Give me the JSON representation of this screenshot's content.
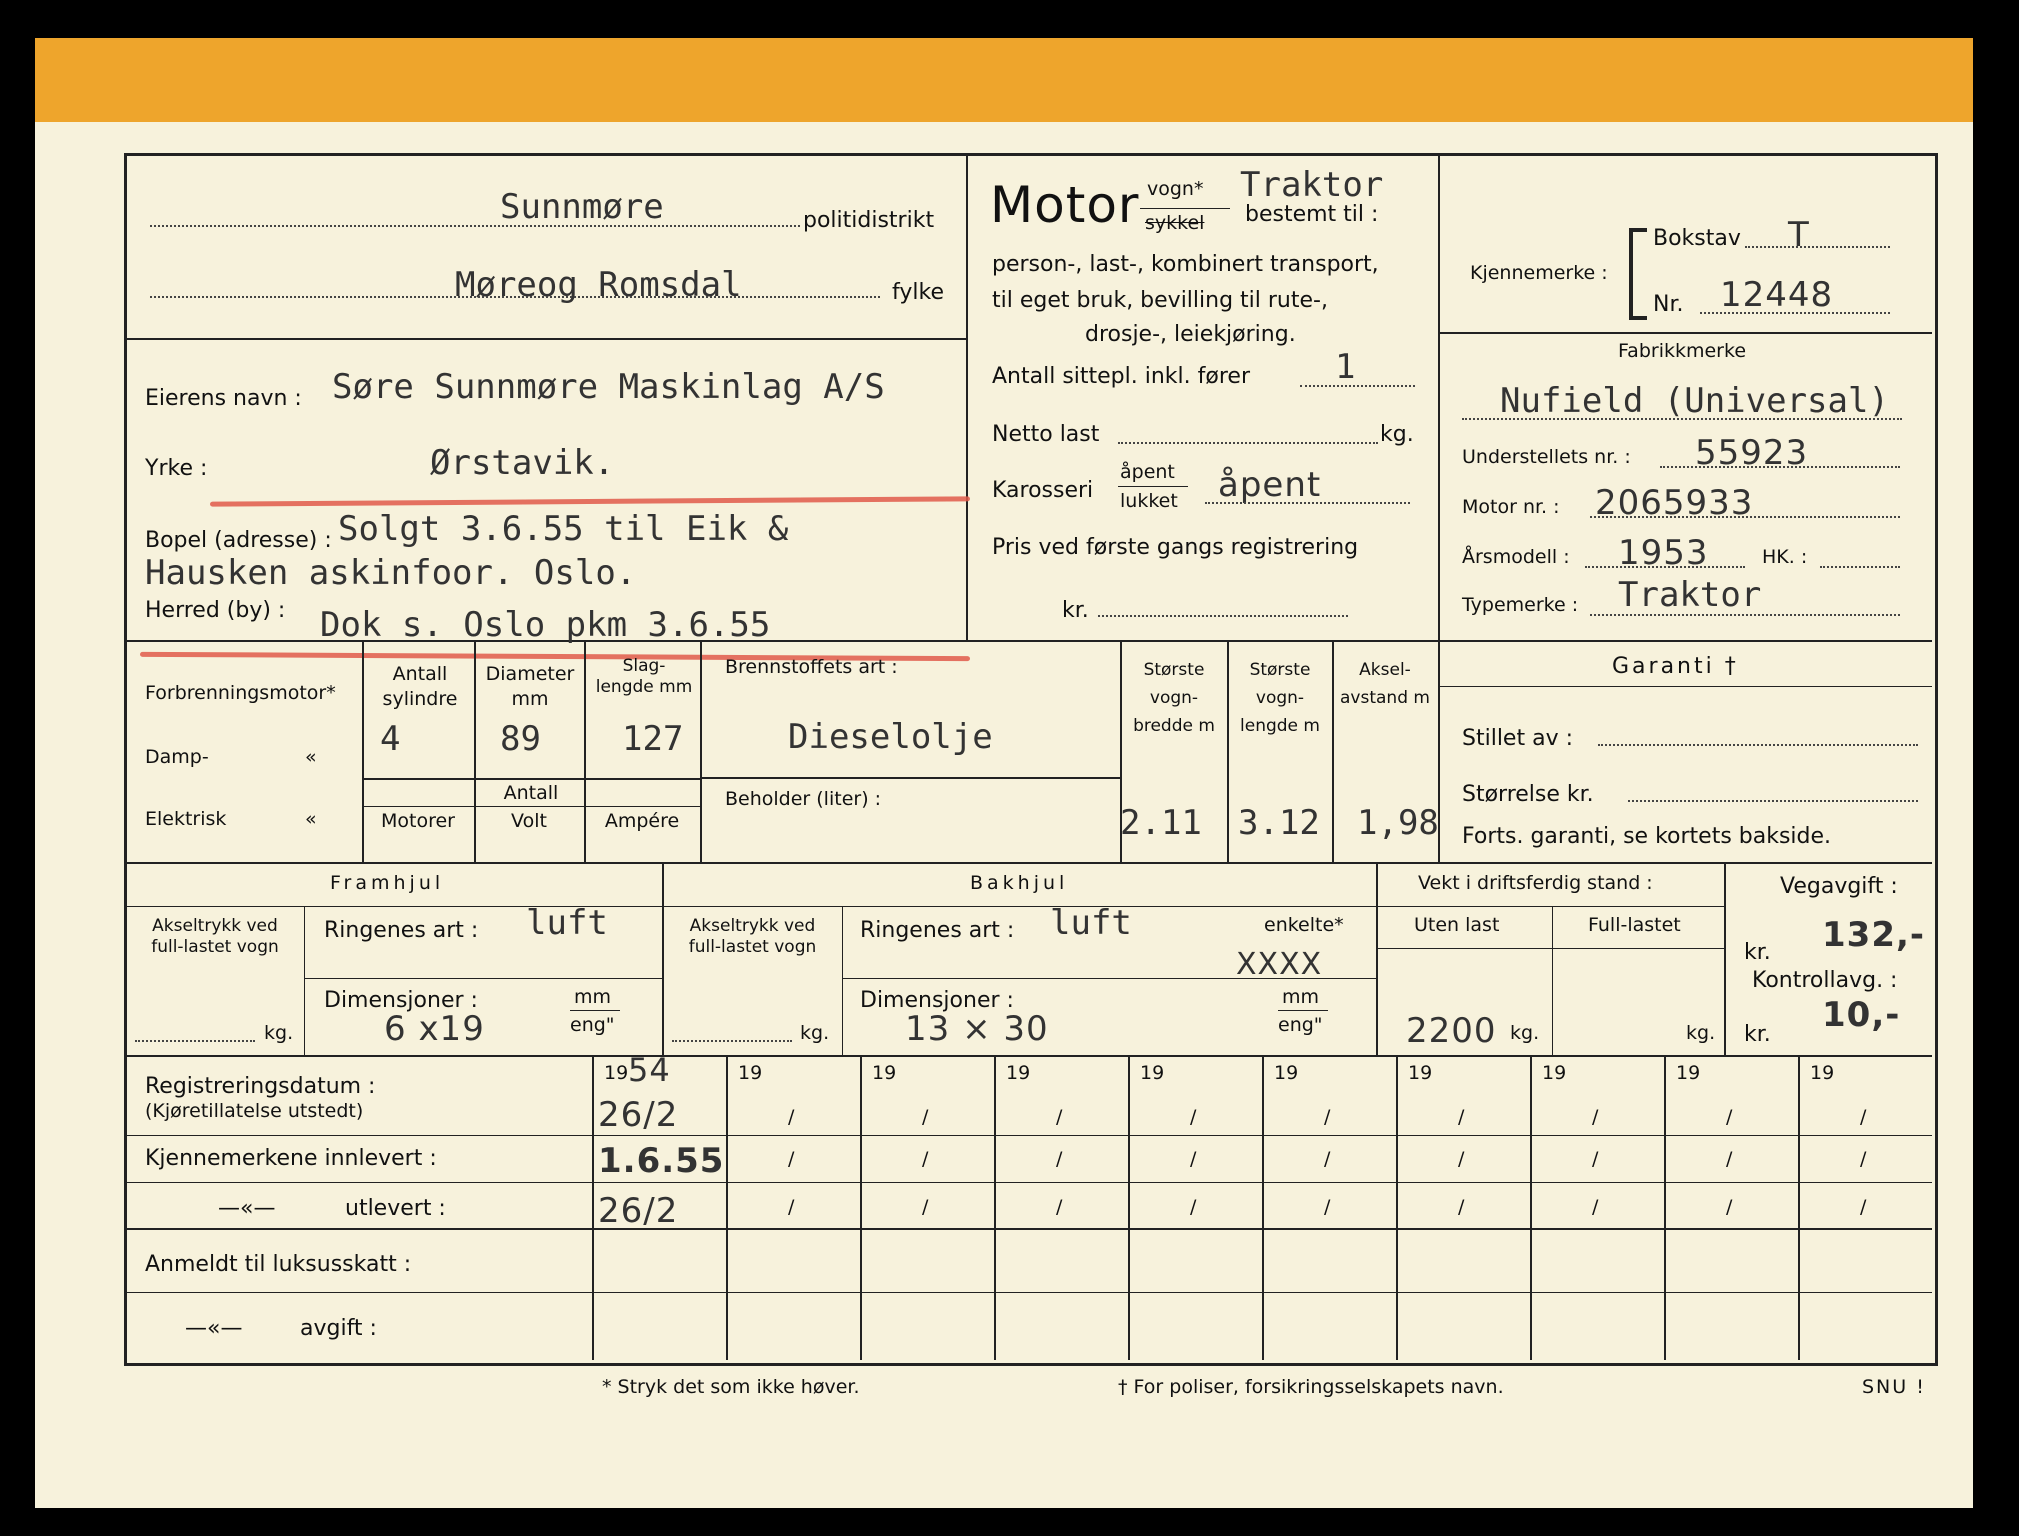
{
  "header": {
    "police_district_value": "Sunnmøre",
    "police_district_label": "politidistrikt",
    "county_value": "Møreog Romsdal",
    "county_label": "fylke"
  },
  "owner": {
    "name_label": "Eierens navn :",
    "name_value": "Søre Sunnmøre Maskinlag A/S",
    "occupation_label": "Yrke :",
    "occupation_value": "Ørstavik.",
    "address_label": "Bopel (adresse) :",
    "address_value": "Solgt 3.6.55 til Eik &",
    "address_value2": "Hausken askinfoor. Oslo.",
    "district_label": "Herred (by) :",
    "district_value": "Dok s. Oslo pkm 3.6.55"
  },
  "vehicle_type": {
    "motor": "Motor",
    "vogn": "vogn*",
    "sykkel": "sykkel",
    "traktor": "Traktor",
    "bestemt": "bestemt til :",
    "line1": "person-, last-, kombinert transport,",
    "line2": "til eget bruk, bevilling til rute-,",
    "line3": "drosje-, leiekjøring.",
    "seats_label": "Antall sittepl. inkl. fører",
    "seats_value": "1",
    "netto_label": "Netto last",
    "netto_unit": "kg.",
    "body_label": "Karosseri",
    "body_open": "åpent",
    "body_closed": "lukket",
    "body_value": "åpent",
    "price_label": "Pris ved første gangs registrering",
    "price_unit": "kr."
  },
  "registration": {
    "plate_label": "Kjennemerke :",
    "letter_label": "Bokstav",
    "letter_value": "T",
    "nr_label": "Nr.",
    "nr_value": "12448",
    "make_label": "Fabrikkmerke",
    "make_value": "Nufield (Universal)",
    "chassis_label": "Understellets nr. :",
    "chassis_value": "55923",
    "engine_label": "Motor nr. :",
    "engine_value": "2065933",
    "year_label": "Årsmodell :",
    "year_value": "1953",
    "hp_label": "HK. :",
    "type_label": "Typemerke :",
    "type_value": "Traktor"
  },
  "engine": {
    "combustion": "Forbrenningsmotor*",
    "steam": "Damp-",
    "electric": "Elektrisk",
    "ditto": "«",
    "cyl_label": "Antall sylindre",
    "diam_label": "Diameter mm",
    "stroke_label": "Slag- lengde mm",
    "cyl": "4",
    "diam": "89",
    "stroke": "127",
    "antall": "Antall",
    "motorer": "Motorer",
    "volt": "Volt",
    "ampere": "Ampére",
    "fuel_label": "Brennstoffets art :",
    "fuel_value": "Dieselolje",
    "tank_label": "Beholder (liter) :",
    "width_label": "Største vogn- bredde m",
    "length_label": "Største vogn- lengde m",
    "axle_label": "Aksel- avstand m",
    "width": "2.11",
    "length": "3.12",
    "axle": "1,98"
  },
  "guarantee": {
    "title": "Garanti †",
    "issued": "Stillet av :",
    "size": "Størrelse kr.",
    "cont": "Forts. garanti, se kortets bakside."
  },
  "wheels": {
    "front": "Framhjul",
    "rear": "Bakhjul",
    "axle_load": "Akseltrykk ved full-lastet vogn",
    "kg": "kg.",
    "tire_label": "Ringenes art :",
    "front_tire": "luft",
    "rear_tire": "luft",
    "single": "enkelte*",
    "twin": "XXXX",
    "dim_label": "Dimensjoner :",
    "mm": "mm",
    "eng": "eng\"",
    "front_dim": "6 x19",
    "rear_dim": "13 × 30"
  },
  "weight": {
    "title": "Vekt i driftsferdig stand :",
    "unladen": "Uten last",
    "laden": "Full-lastet",
    "unladen_value": "2200",
    "kg": "kg."
  },
  "fees": {
    "road_label": "Vegavgift :",
    "kr": "kr.",
    "road_value": "132,-",
    "control_label": "Kontrollavg. :",
    "control_value": "10,-"
  },
  "dates": {
    "reg_label": "Registreringsdatum :",
    "reg_sub": "(Kjøretillatelse utstedt)",
    "returned_label": "Kjennemerkene innlevert :",
    "ditto": "—«—",
    "issued_label": "utlevert :",
    "luxury_label": "Anmeldt til luksusskatt :",
    "fee_label": "avgift :",
    "year_prefix": "19",
    "slash": "/",
    "first_year": "54",
    "first_reg": "26/2",
    "first_returned": "1.6.55",
    "first_issued": "26/2"
  },
  "footer": {
    "note1": "* Stryk det som ikke høver.",
    "note2": "† For poliser, forsikringsselskapets navn.",
    "note3": "SNU !"
  }
}
